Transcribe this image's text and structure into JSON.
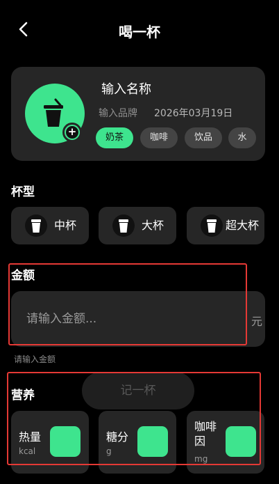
{
  "header": {
    "title": "喝一杯"
  },
  "drink": {
    "name_placeholder": "输入名称",
    "brand_placeholder": "输入品牌",
    "date": "2026年03月19日",
    "categories": [
      "奶茶",
      "咖啡",
      "饮品",
      "水"
    ],
    "selected_category": "奶茶"
  },
  "cup_type": {
    "title": "杯型",
    "sizes": [
      "中杯",
      "大杯",
      "超大杯"
    ]
  },
  "amount": {
    "title": "金额",
    "placeholder": "请输入金额...",
    "currency": "元",
    "hint": "请输入金额"
  },
  "log_button": {
    "label": "记一杯"
  },
  "nutrition": {
    "title": "营养",
    "items": [
      {
        "label": "热量",
        "unit": "kcal"
      },
      {
        "label": "糖分",
        "unit": "g"
      },
      {
        "label": "咖啡因",
        "label_line1": "咖啡",
        "label_line2": "因",
        "unit": "mg"
      }
    ]
  },
  "colors": {
    "accent": "#3ee48e",
    "card": "#262626",
    "background": "#000000",
    "highlight": "#e53935"
  },
  "icons": {
    "back": "chevron-left-icon",
    "cup": "cup-icon",
    "add": "plus-icon"
  }
}
